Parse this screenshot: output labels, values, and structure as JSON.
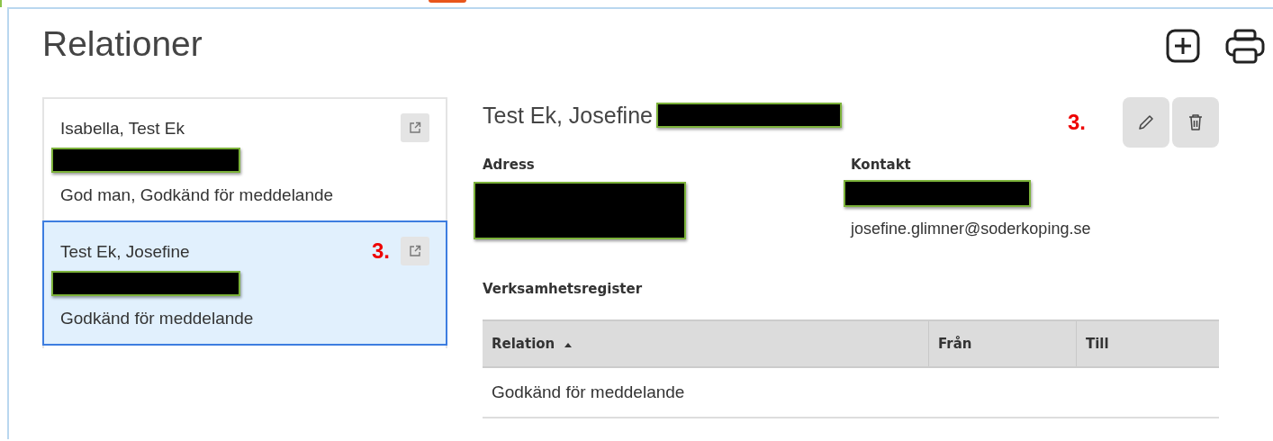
{
  "title": "Relationer",
  "toolbar": [
    {
      "kind": "add"
    },
    {
      "kind": "print"
    }
  ],
  "relations": [
    {
      "name": "Isabella, Test Ek",
      "redacted": true,
      "roles": "God man, Godkänd för meddelande",
      "selected": false
    },
    {
      "name": "Test Ek, Josefine",
      "redacted": true,
      "roles": "Godkänd för meddelande",
      "selected": true,
      "annotation": "3."
    }
  ],
  "detail": {
    "name": "Test Ek, Josefine",
    "redacted": true,
    "annotation": "3.",
    "actions": [
      {
        "kind": "edit"
      },
      {
        "kind": "delete"
      }
    ],
    "address": {
      "label": "Adress",
      "redacted": true
    },
    "contact": {
      "label": "Kontakt",
      "redacted": true,
      "email": "josefine.glimner@soderkoping.se"
    },
    "register": {
      "title": "Verksamhetsregister",
      "columns": [
        {
          "label": "Relation",
          "sorted": true
        },
        {
          "label": "Från",
          "sorted": false
        },
        {
          "label": "Till",
          "sorted": false
        }
      ],
      "rows": [
        [
          "Godkänd för meddelande",
          "",
          ""
        ]
      ]
    }
  }
}
